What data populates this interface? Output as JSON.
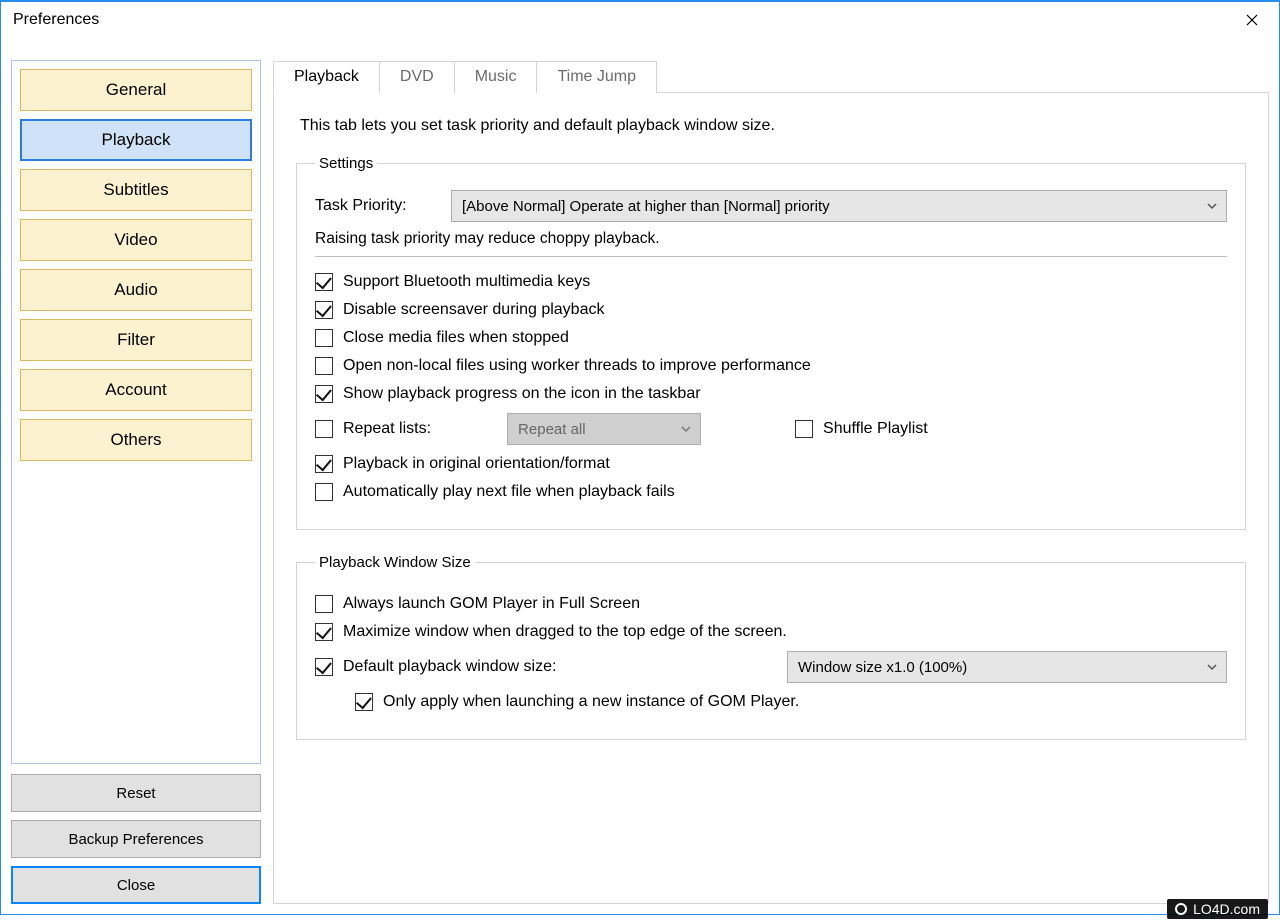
{
  "window": {
    "title": "Preferences"
  },
  "sidebar": {
    "items": [
      {
        "label": "General",
        "active": false
      },
      {
        "label": "Playback",
        "active": true
      },
      {
        "label": "Subtitles",
        "active": false
      },
      {
        "label": "Video",
        "active": false
      },
      {
        "label": "Audio",
        "active": false
      },
      {
        "label": "Filter",
        "active": false
      },
      {
        "label": "Account",
        "active": false
      },
      {
        "label": "Others",
        "active": false
      }
    ],
    "reset_label": "Reset",
    "backup_label": "Backup Preferences",
    "close_label": "Close"
  },
  "tabs": [
    {
      "label": "Playback",
      "active": true
    },
    {
      "label": "DVD",
      "active": false
    },
    {
      "label": "Music",
      "active": false
    },
    {
      "label": "Time Jump",
      "active": false
    }
  ],
  "playback": {
    "description": "This tab lets you set task priority and default playback window size.",
    "settings_legend": "Settings",
    "task_priority_label": "Task Priority:",
    "task_priority_value": "[Above Normal] Operate at higher than [Normal] priority",
    "task_priority_note": "Raising task priority may reduce choppy playback.",
    "checks": {
      "bluetooth": {
        "label": "Support Bluetooth multimedia keys",
        "checked": true
      },
      "screensaver": {
        "label": "Disable screensaver during playback",
        "checked": true
      },
      "close_stop": {
        "label": "Close media files when stopped",
        "checked": false
      },
      "worker": {
        "label": "Open non-local files using worker threads to improve performance",
        "checked": false
      },
      "taskbar": {
        "label": "Show playback progress on the icon in the taskbar",
        "checked": true
      },
      "repeat": {
        "label": "Repeat lists:",
        "checked": false
      },
      "repeat_mode": "Repeat all",
      "shuffle": {
        "label": "Shuffle Playlist",
        "checked": false
      },
      "orientation": {
        "label": "Playback in original orientation/format",
        "checked": true
      },
      "autonext": {
        "label": "Automatically play next file when playback fails",
        "checked": false
      }
    },
    "ws_legend": "Playback Window Size",
    "ws": {
      "fullscreen": {
        "label": "Always launch GOM Player in Full Screen",
        "checked": false
      },
      "maximize": {
        "label": "Maximize window when dragged to the top edge of the screen.",
        "checked": true
      },
      "default": {
        "label": "Default playback window size:",
        "checked": true
      },
      "default_value": "Window size x1.0 (100%)",
      "only_new": {
        "label": "Only apply when launching a new instance of GOM Player.",
        "checked": true
      }
    }
  },
  "watermark": "LO4D.com"
}
